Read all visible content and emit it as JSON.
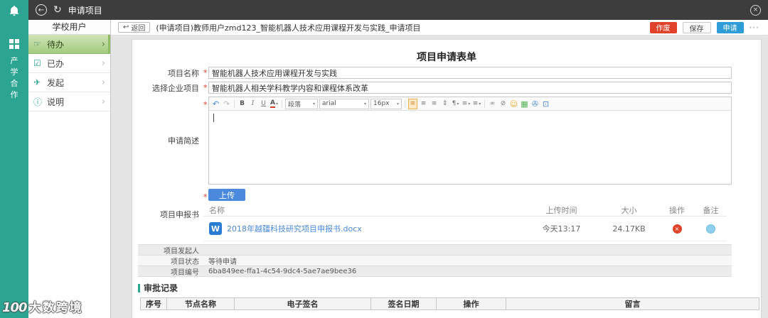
{
  "topbar": {
    "title": "申请项目"
  },
  "rail": {
    "label": "产学合作"
  },
  "watermark": {
    "logo": "100",
    "text": "大数跨境"
  },
  "sidebar": {
    "header": "学校用户",
    "items": [
      {
        "label": "待办",
        "active": true
      },
      {
        "label": "已办",
        "active": false
      },
      {
        "label": "发起",
        "active": false
      },
      {
        "label": "说明",
        "active": false
      }
    ]
  },
  "toolbar": {
    "back": "返回",
    "breadcrumb": "(申请项目)教师用户zmd123_智能机器人技术应用课程开发与实践_申请项目",
    "void": "作废",
    "save": "保存",
    "apply": "申请",
    "more": "···"
  },
  "form": {
    "title": "项目申请表单",
    "required_mark": "*",
    "project_name": {
      "label": "项目名称",
      "value": "智能机器人技术应用课程开发与实践"
    },
    "enterprise_project": {
      "label": "选择企业项目",
      "value": "智能机器人相关学科教学内容和课程体系改革"
    },
    "brief": {
      "label": "申请简述"
    },
    "editor": {
      "paragraph": "段落",
      "font": "arial",
      "size": "16px",
      "bold": "B",
      "italic": "I",
      "underline": "U",
      "color": "A"
    },
    "report": {
      "label": "项目申报书",
      "upload": "上传",
      "headers": {
        "name": "名称",
        "time": "上传时间",
        "size": "大小",
        "action": "操作",
        "remark": "备注"
      },
      "files": [
        {
          "badge": "W",
          "name": "2018年越疆科技研究项目申报书.docx",
          "time": "今天13:17",
          "size": "24.17KB"
        }
      ]
    },
    "initiator": {
      "label": "项目发起人",
      "value": ""
    },
    "status": {
      "label": "项目状态",
      "value": "等待申请"
    },
    "number": {
      "label": "项目编号",
      "value": "6ba849ee-ffa1-4c54-9dc4-5ae7ae9bee36"
    }
  },
  "approval": {
    "title": "审批记录",
    "headers": [
      "序号",
      "节点名称",
      "电子签名",
      "签名日期",
      "操作",
      "留言"
    ]
  },
  "icons": {
    "back": "←",
    "refresh": "↻",
    "close": "×",
    "chevron": "›",
    "todo": "☞",
    "done": "☑",
    "initiate": "✈",
    "info": "ⓘ",
    "return_arrow": "↩",
    "undo": "↶",
    "redo": "↷",
    "caret": "▾",
    "align": "≡",
    "line_height": "⇕",
    "pilcrow": "¶",
    "link": "∞",
    "unlink": "⊘",
    "smiley": "☺",
    "image": "▦",
    "attach": "✇",
    "media": "⊡",
    "delete": "×"
  },
  "colors": {
    "teal": "#2ba492",
    "danger": "#e0432a",
    "primary": "#2e9cd6",
    "upload_blue": "#4a89dc"
  }
}
